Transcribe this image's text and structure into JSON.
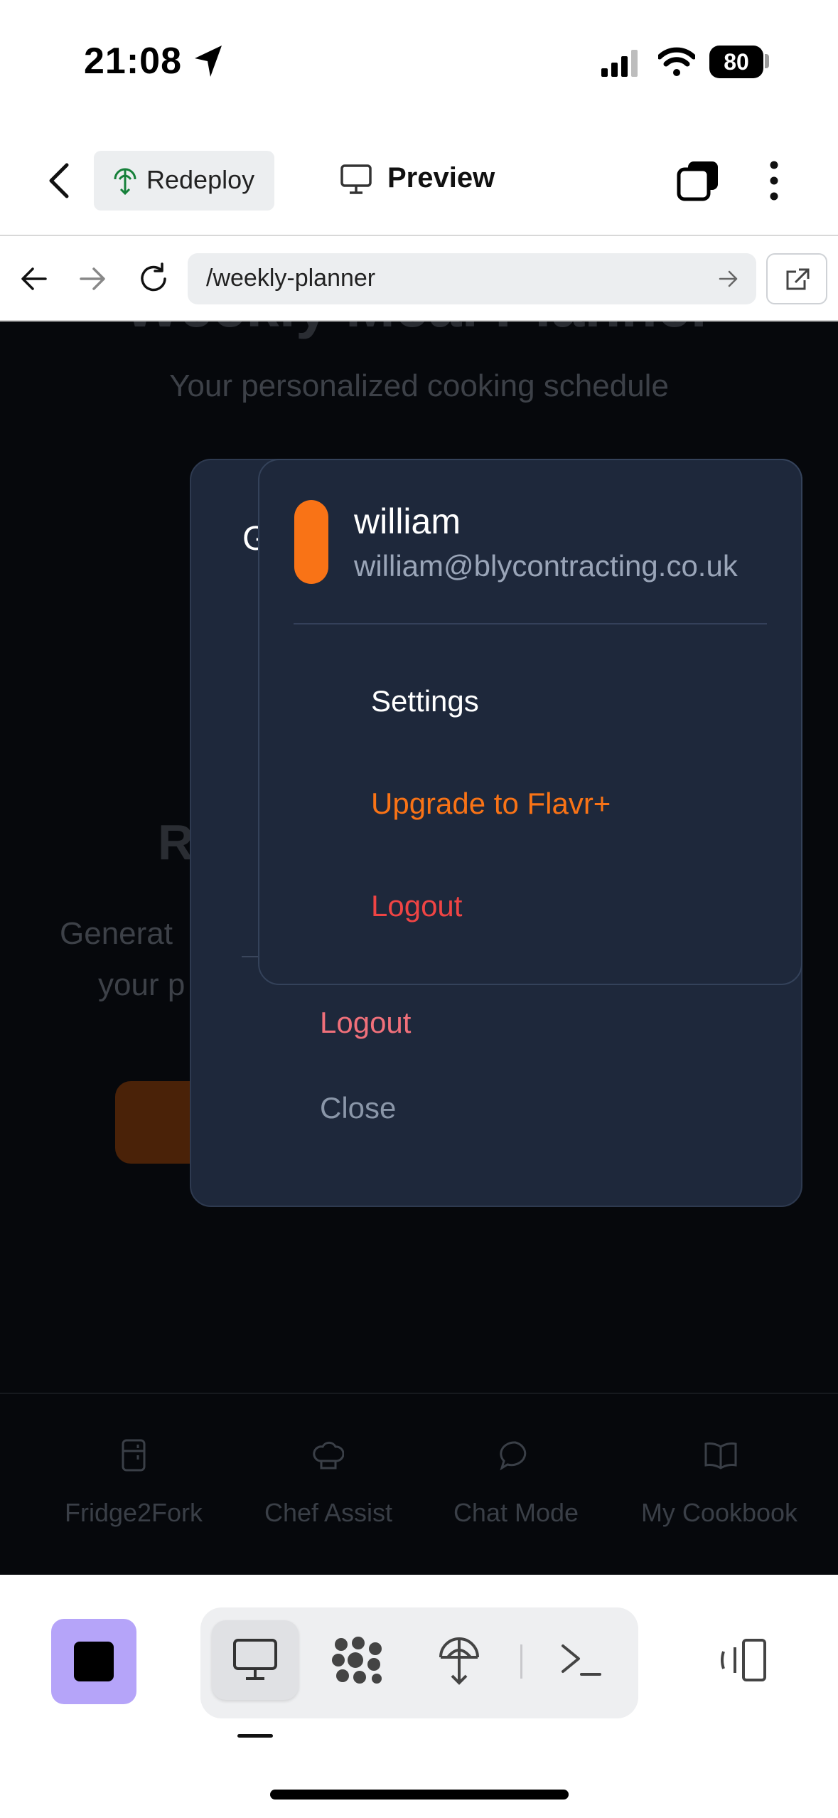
{
  "status_bar": {
    "time": "21:08",
    "battery": "80"
  },
  "app_header": {
    "redeploy_label": "Redeploy",
    "preview_label": "Preview"
  },
  "browser": {
    "url": "/weekly-planner"
  },
  "page_background": {
    "title": "Weekly Meal Planner",
    "subtitle": "Your personalized cooking schedule",
    "heading_fragment": "R",
    "text_line1": "Generat",
    "text_line2": "your p",
    "nav": [
      "Fridge2Fork",
      "Chef Assist",
      "Chat Mode",
      "My Cookbook"
    ]
  },
  "outer_dialog": {
    "title_fragment": "G",
    "logout_label": "Logout",
    "close_label": "Close"
  },
  "user_menu": {
    "name": "william",
    "email": "william@blycontracting.co.uk",
    "items": [
      "Settings",
      "Upgrade to Flavr+",
      "Logout"
    ],
    "avatar_color": "#f97316"
  },
  "colors": {
    "accent": "#f97316",
    "danger": "#ef4444",
    "stop_button": "#b5a4f9"
  }
}
